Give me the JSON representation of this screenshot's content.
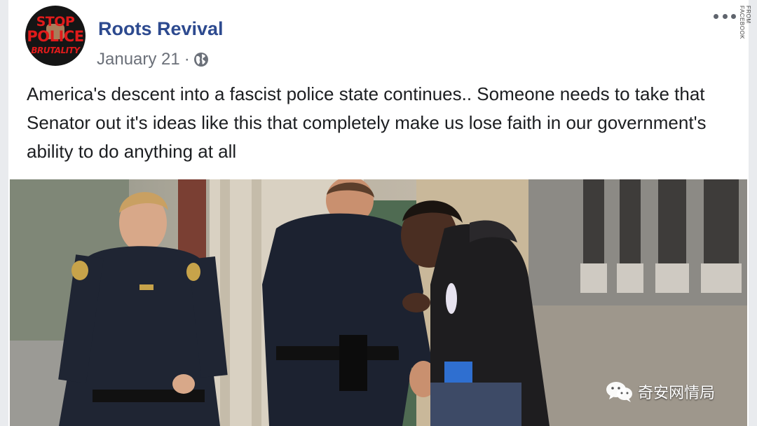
{
  "source_label": "FROM FACEBOOK",
  "post": {
    "avatar": {
      "line1": "STOP",
      "line2": "POLICE",
      "line3": "BRUTALITY"
    },
    "page_name": "Roots Revival",
    "date": "January 21",
    "separator": "·",
    "privacy_icon": "globe-icon",
    "more_icon": "more-options-icon",
    "text": "America's descent into a fascist police state continues.. Someone needs to take that Senator out it's ideas like this that completely make us lose faith in our government's ability to do anything at all"
  },
  "watermark": {
    "icon": "wechat-icon",
    "text": "奇安网情局"
  },
  "colors": {
    "page_name": "#2d4a8f",
    "meta_text": "#6b7079",
    "post_text": "#1c1e21",
    "page_bg": "#e9ebee"
  }
}
